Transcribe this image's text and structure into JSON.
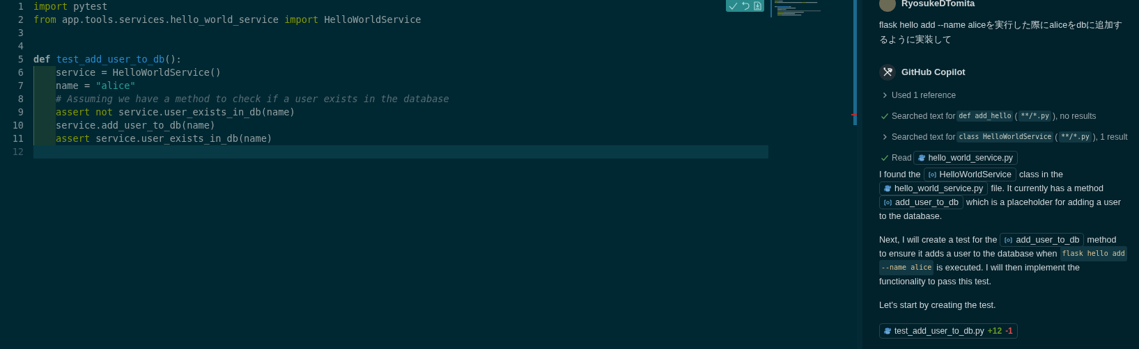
{
  "editor": {
    "lines": [
      {
        "number": "1",
        "current": false,
        "indented": false,
        "tokens": [
          {
            "kind": "kw",
            "text": "import"
          },
          {
            "kind": "plain",
            "text": " pytest"
          }
        ]
      },
      {
        "number": "2",
        "current": false,
        "indented": false,
        "tokens": [
          {
            "kind": "kw",
            "text": "from"
          },
          {
            "kind": "plain",
            "text": " app.tools.services.hello_world_service "
          },
          {
            "kind": "kw",
            "text": "import"
          },
          {
            "kind": "plain",
            "text": " HelloWorldService"
          }
        ]
      },
      {
        "number": "3",
        "current": false,
        "indented": false
      },
      {
        "number": "4",
        "current": false,
        "indented": false
      },
      {
        "number": "5",
        "current": false,
        "indented": false,
        "tokens": [
          {
            "kind": "def",
            "text": "def "
          },
          {
            "kind": "fn",
            "text": "test_add_user_to_db"
          },
          {
            "kind": "plain",
            "text": "():"
          }
        ]
      },
      {
        "number": "6",
        "current": false,
        "indented": true,
        "tokens": [
          {
            "kind": "plain",
            "text": "service = HelloWorldService()"
          }
        ]
      },
      {
        "number": "7",
        "current": false,
        "indented": true,
        "tokens": [
          {
            "kind": "plain",
            "text": "name = "
          },
          {
            "kind": "str",
            "text": "\"alice\""
          }
        ]
      },
      {
        "number": "8",
        "current": false,
        "indented": true,
        "tokens": [
          {
            "kind": "comment",
            "text": "# Assuming we have a method to check if a user exists in the database"
          }
        ]
      },
      {
        "number": "9",
        "current": false,
        "indented": true,
        "tokens": [
          {
            "kind": "kw",
            "text": "assert not"
          },
          {
            "kind": "plain",
            "text": " service.user_exists_in_db(name)"
          }
        ]
      },
      {
        "number": "10",
        "current": false,
        "indented": true,
        "tokens": [
          {
            "kind": "plain",
            "text": "service.add_user_to_db(name)"
          }
        ]
      },
      {
        "number": "11",
        "current": false,
        "indented": true,
        "tokens": [
          {
            "kind": "kw",
            "text": "assert"
          },
          {
            "kind": "plain",
            "text": " service.user_exists_in_db(name)"
          }
        ]
      },
      {
        "number": "12",
        "current": true,
        "indented": false
      }
    ]
  },
  "chat": {
    "user": {
      "name": "RyosukeDTomita",
      "message": [
        "flask hello add --name aliceを実行した際にaliceをdbに追加す",
        "るように実装して"
      ]
    },
    "assistant": {
      "name": "GitHub Copilot",
      "steps": [
        {
          "kind": "collapsed",
          "segments": [
            {
              "kind": "text",
              "text": "Used 1 reference"
            }
          ]
        },
        {
          "kind": "done",
          "segments": [
            {
              "kind": "text",
              "text": "Searched text for"
            },
            {
              "kind": "code",
              "text": "def add_hello"
            },
            {
              "kind": "text",
              "text": "("
            },
            {
              "kind": "code",
              "text": "**/*.py"
            },
            {
              "kind": "text",
              "text": "), no results"
            }
          ]
        },
        {
          "kind": "collapsed",
          "segments": [
            {
              "kind": "text",
              "text": "Searched text for"
            },
            {
              "kind": "code",
              "text": "class HelloWorldService"
            },
            {
              "kind": "text",
              "text": "("
            },
            {
              "kind": "code",
              "text": "**/*.py"
            },
            {
              "kind": "text",
              "text": "), 1 result"
            }
          ]
        },
        {
          "kind": "done",
          "segments": [
            {
              "kind": "text",
              "text": "Read"
            },
            {
              "kind": "file",
              "text": "hello_world_service.py"
            }
          ]
        }
      ],
      "paragraphs": [
        [
          [
            {
              "kind": "text",
              "text": "I found the"
            },
            {
              "kind": "symbol",
              "text": "HelloWorldService"
            },
            {
              "kind": "text",
              "text": "class in the"
            }
          ],
          [
            {
              "kind": "file",
              "text": "hello_world_service.py"
            },
            {
              "kind": "text",
              "text": "file. It currently has a method"
            }
          ],
          [
            {
              "kind": "symbol",
              "text": "add_user_to_db"
            },
            {
              "kind": "text",
              "text": "which is a placeholder for adding a user"
            }
          ],
          [
            {
              "kind": "text",
              "text": "to the database."
            }
          ]
        ],
        [
          [
            {
              "kind": "text",
              "text": "Next, I will create a test for the"
            },
            {
              "kind": "symbol",
              "text": "add_user_to_db"
            },
            {
              "kind": "text",
              "text": "method"
            }
          ],
          [
            {
              "kind": "text",
              "text": "to ensure it adds a user to the database when"
            },
            {
              "kind": "code",
              "text": "flask hello add"
            }
          ],
          [
            {
              "kind": "code",
              "text": "--name alice"
            },
            {
              "kind": "text",
              "text": "is executed. I will then implement the"
            }
          ],
          [
            {
              "kind": "text",
              "text": "functionality to pass this test."
            }
          ]
        ],
        [
          [
            {
              "kind": "text",
              "text": "Let's start by creating the test."
            }
          ]
        ]
      ],
      "edit": {
        "file": "test_add_user_to_db.py",
        "added": "+12",
        "removed": "-1"
      }
    }
  }
}
